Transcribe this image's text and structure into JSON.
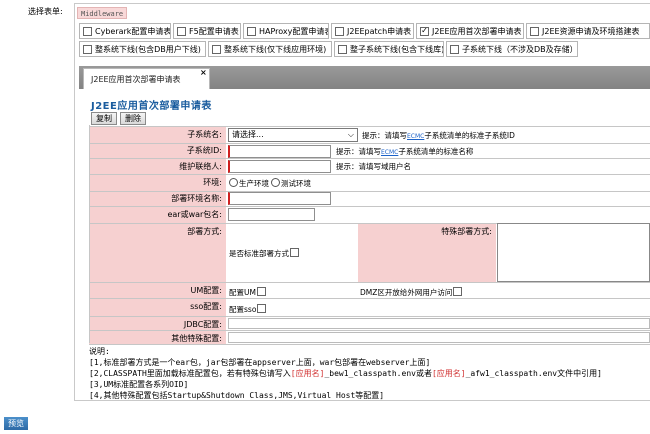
{
  "select_label": "选择表单:",
  "tag_label": "Middleware",
  "form_options": [
    {
      "label": "Cyberark配置申请表",
      "checked": false
    },
    {
      "label": "F5配置申请表",
      "checked": false
    },
    {
      "label": "HAProxy配置申请表",
      "checked": false
    },
    {
      "label": "J2EEpatch申请表",
      "checked": false
    },
    {
      "label": "J2EE应用首次部署申请表",
      "checked": true,
      "mark": "✓"
    },
    {
      "label": "J2EE资源申请及环境搭建表",
      "checked": false
    },
    {
      "label": "整系统下线(包含DB用户下线)",
      "checked": false
    },
    {
      "label": "整系统下线(仅下线应用环境)",
      "checked": false
    },
    {
      "label": "整子系统下线(包含下线库)",
      "checked": false
    },
    {
      "label": "子系统下线（不涉及DB及存储）",
      "checked": false
    }
  ],
  "tab": {
    "label": "J2EE应用首次部署申请表",
    "close": "×"
  },
  "form_title": "J2EE应用首次部署申请表",
  "buttons": {
    "copy": "复制",
    "delete": "删除"
  },
  "fields": {
    "subsystem_name": {
      "label": "子系统名:",
      "value": "请选择...",
      "hint": "提示：请填写",
      "hint_link": "ECMC",
      "hint_rest": "子系统清单的标准子系统ID"
    },
    "subsystem_id": {
      "label": "子系统ID:",
      "hint": "提示：请填写",
      "hint_link": "ECMC",
      "hint_rest": "子系统清单的标准名称"
    },
    "maintainer": {
      "label": "维护联络人:",
      "hint": "提示：请填写域用户名"
    },
    "environment": {
      "label": "环境:",
      "opt1": "生产环境",
      "opt2": "测试环境"
    },
    "deploy_env_name": {
      "label": "部署环境名称:"
    },
    "package_name": {
      "label": "ear或war包名:"
    },
    "deploy_method": {
      "label": "部署方式:",
      "standard": "是否标准部署方式",
      "special": "特殊部署方式:"
    },
    "um_config": {
      "label": "UM配置:",
      "check": "配置UM",
      "dmz": "DMZ区开放给外网用户访问"
    },
    "sso_config": {
      "label": "sso配置:",
      "check": "配置sso"
    },
    "jdbc_config": {
      "label": "JDBC配置:"
    },
    "other_config": {
      "label": "其他特殊配置:"
    }
  },
  "notes": {
    "title": "说明:",
    "line1": "[1,标准部署方式是一个ear包，jar包部署在appserver上面，war包部署在webserver上面]",
    "line2_a": "[2,CLASSPATH里面加载标准配置包，若有特殊包请写入",
    "line2_red1": "[应用名]",
    "line2_b": "_bew1_classpath.env或者",
    "line2_red2": "[应用名]",
    "line2_c": "_afw1_classpath.env文件中引用]",
    "line3": "[3,UM标准配置各系列OID]",
    "line4": "[4,其他特殊配置包括Startup&Shutdown Class,JMS,Virtual Host等配置]"
  },
  "preview_label": "预览"
}
